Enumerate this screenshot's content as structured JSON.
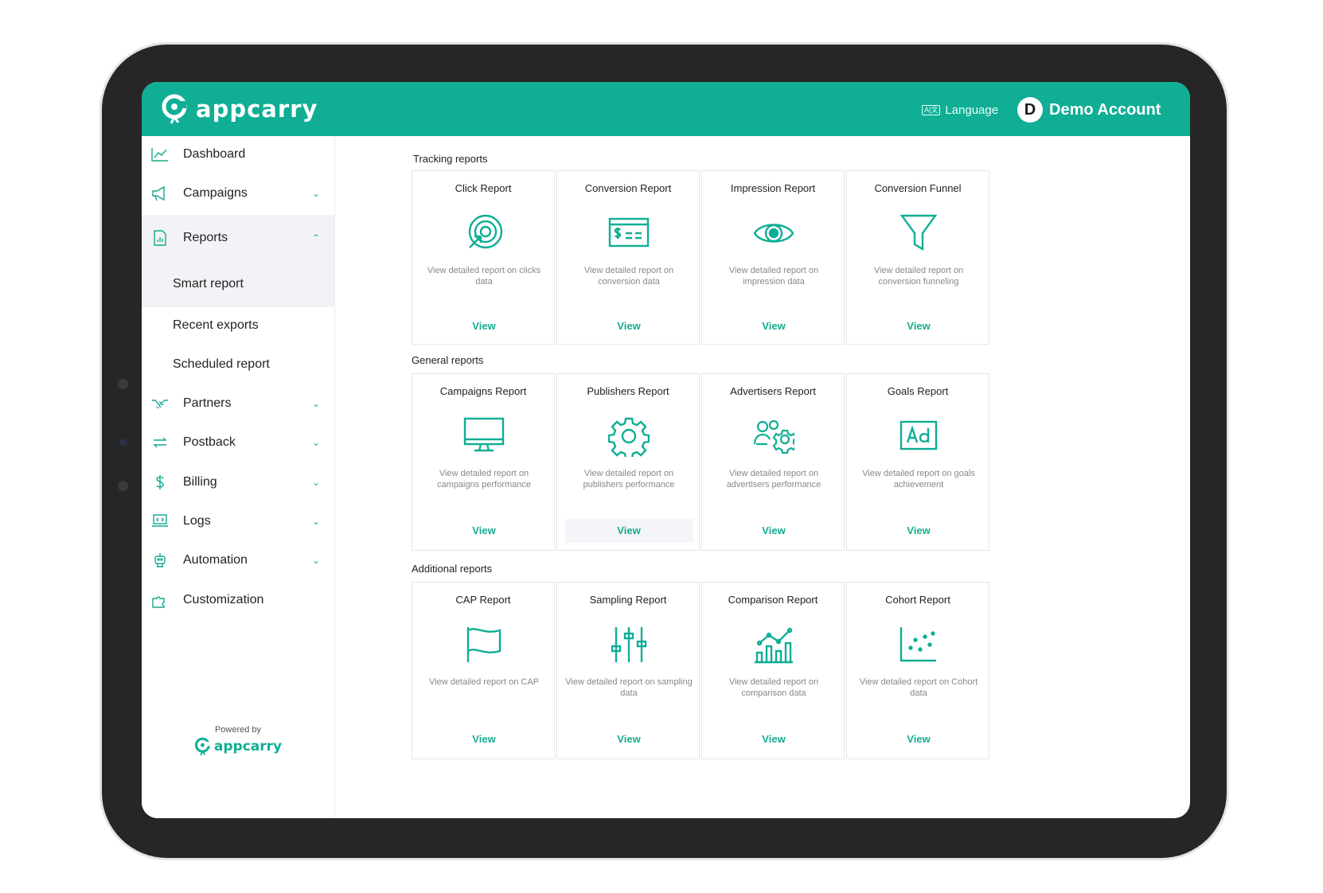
{
  "brand": {
    "name": "appcarry",
    "color": "#0fae95"
  },
  "header": {
    "language_label": "Language",
    "language_icon": "A|文",
    "avatar_letter": "D",
    "account_name": "Demo Account"
  },
  "sidebar": {
    "items": [
      {
        "label": "Dashboard",
        "icon": "chart-line-icon"
      },
      {
        "label": "Campaigns",
        "icon": "megaphone-icon"
      },
      {
        "label": "Reports",
        "icon": "report-file-icon"
      },
      {
        "label": "Partners",
        "icon": "handshake-icon"
      },
      {
        "label": "Postback",
        "icon": "arrows-icon"
      },
      {
        "label": "Billing",
        "icon": "dollar-icon"
      },
      {
        "label": "Logs",
        "icon": "laptop-code-icon"
      },
      {
        "label": "Automation",
        "icon": "robot-icon"
      },
      {
        "label": "Customization",
        "icon": "puzzle-icon"
      }
    ],
    "reports_sub": [
      {
        "label": "Smart report"
      },
      {
        "label": "Recent exports"
      },
      {
        "label": "Scheduled report"
      }
    ],
    "powered_by": "Powered by",
    "powered_brand": "appcarry"
  },
  "sections": [
    {
      "title": "Tracking reports",
      "cards": [
        {
          "title": "Click Report",
          "icon": "target-click-icon",
          "desc": "View detailed report on clicks data",
          "view": "View"
        },
        {
          "title": "Conversion Report",
          "icon": "money-bill-icon",
          "desc": "View detailed report on conversion data",
          "view": "View"
        },
        {
          "title": "Impression Report",
          "icon": "eye-icon",
          "desc": "View detailed report on impression data",
          "view": "View"
        },
        {
          "title": "Conversion Funnel",
          "icon": "funnel-icon",
          "desc": "View detailed report on conversion funneling",
          "view": "View"
        }
      ]
    },
    {
      "title": "General reports",
      "cards": [
        {
          "title": "Campaigns Report",
          "icon": "monitor-icon",
          "desc": "View detailed report on campaigns performance",
          "view": "View"
        },
        {
          "title": "Publishers Report",
          "icon": "gear-icon",
          "desc": "View detailed report on publishers performance",
          "view": "View"
        },
        {
          "title": "Advertisers Report",
          "icon": "users-gear-icon",
          "desc": "View detailed report on advertisers performance",
          "view": "View"
        },
        {
          "title": "Goals Report",
          "icon": "ad-icon",
          "desc": "View detailed report on goals achievement",
          "view": "View"
        }
      ]
    },
    {
      "title": "Additional reports",
      "cards": [
        {
          "title": "CAP Report",
          "icon": "flag-icon",
          "desc": "View detailed report on CAP",
          "view": "View"
        },
        {
          "title": "Sampling Report",
          "icon": "sliders-icon",
          "desc": "View detailed report on sampling data",
          "view": "View"
        },
        {
          "title": "Comparison Report",
          "icon": "bar-line-chart-icon",
          "desc": "View detailed report on comparison data",
          "view": "View"
        },
        {
          "title": "Cohort Report",
          "icon": "scatter-chart-icon",
          "desc": "View detailed report on Cohort data",
          "view": "View"
        }
      ]
    }
  ]
}
